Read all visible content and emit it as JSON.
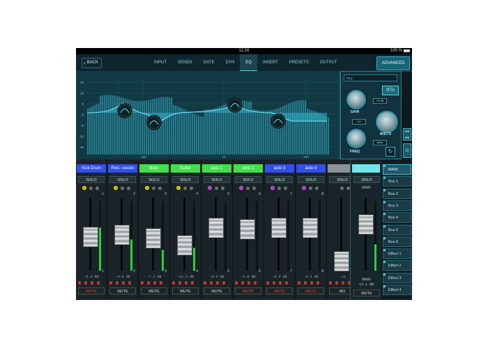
{
  "status": {
    "time": "12:16",
    "battery": "100 %"
  },
  "nav": {
    "back": "BACK",
    "tabs": [
      "INPUT",
      "SENDS",
      "GATE",
      "DYN",
      "EQ",
      "INSERT",
      "PRESETS",
      "OUTPUT"
    ],
    "active_tab": "EQ",
    "advanced": "ADVANCED"
  },
  "eq": {
    "y_labels": [
      "15",
      "10",
      "5",
      "0",
      "-5",
      "-10",
      "-15"
    ],
    "x_labels": [
      "100",
      "1K",
      "10K"
    ],
    "preset": "PEQ",
    "rta": "RTA",
    "gain": {
      "label": "GAIN",
      "value": "2.5 dB"
    },
    "freq": {
      "label": "FREQ",
      "value": "6KHz"
    },
    "width": {
      "label": "WIDTH",
      "value": "2.0"
    }
  },
  "channels": [
    {
      "name": "Kick Drum",
      "color": "#2f4ff0",
      "num": "1",
      "db": "-6.3 dB",
      "mute": "MUTE",
      "mute_on": true,
      "badge": "1",
      "badge_color": "#e6d000",
      "fader": 0.55,
      "meter": 0.62
    },
    {
      "name": "Perc- ussion",
      "color": "#2f4ff0",
      "num": "2",
      "db": "-4.9 dB",
      "mute": "MUTE",
      "mute_on": false,
      "badge": "1",
      "badge_color": "#e6d000",
      "fader": 0.58,
      "meter": 0.45
    },
    {
      "name": "Bass",
      "color": "#3fe04a",
      "num": "3",
      "db": "-7.2 dB",
      "mute": "MUTE",
      "mute_on": false,
      "badge": "1",
      "badge_color": "#e6d000",
      "fader": 0.53,
      "meter": 0.3
    },
    {
      "name": "Guitar",
      "color": "#3fe04a",
      "num": "4",
      "db": "-11.5 dB",
      "mute": "MUTE",
      "mute_on": false,
      "badge": "1",
      "badge_color": "#e6d000",
      "fader": 0.44,
      "meter": 0.33
    },
    {
      "name": "auto 1",
      "color": "#3fe04a",
      "num": "5",
      "db": "-0.4 dB",
      "mute": "MUTE",
      "mute_on": false,
      "badge": "2",
      "badge_color": "#c94be0",
      "fader": 0.68,
      "meter": 0.0
    },
    {
      "name": "auto 2",
      "color": "#3fe04a",
      "num": "6",
      "db": "-1.0 dB",
      "mute": "MUTE",
      "mute_on": true,
      "badge": "2",
      "badge_color": "#c94be0",
      "fader": 0.66,
      "meter": 0.0
    },
    {
      "name": "auto 3",
      "color": "#2f4ff0",
      "num": "7",
      "db": "-0.4 dB",
      "mute": "MUTE",
      "mute_on": true,
      "badge": "2",
      "badge_color": "#c94be0",
      "fader": 0.68,
      "meter": 0.0
    },
    {
      "name": "auto 4",
      "color": "#2f4ff0",
      "num": "8",
      "db": "-0.3 dB",
      "mute": "MUTE",
      "mute_on": true,
      "badge": "2",
      "badge_color": "#c94be0",
      "fader": 0.68,
      "meter": 0.0
    },
    {
      "name": "",
      "color": "#8a9396",
      "num": "",
      "db": "-in",
      "mute": "MU",
      "mute_on": false,
      "badge": "",
      "badge_color": "#8a9396",
      "fader": 0.22,
      "meter": 0.0
    }
  ],
  "main": {
    "solo": "SOLO",
    "top_label": "MAIN",
    "bottom_label": "MAIN",
    "db": "+2.1 dB",
    "mute": "MUTE",
    "fader": 0.72,
    "meter": 0.38
  },
  "solo_label": "SOLO",
  "buses": [
    "MAIN",
    "Bus 1",
    "Bus 2",
    "Bus 3",
    "Bus 4",
    "Bus 5",
    "Bus 6",
    "Effect 1",
    "Effect 2",
    "Effect 3",
    "Effect 4"
  ],
  "selected_bus": "MAIN"
}
